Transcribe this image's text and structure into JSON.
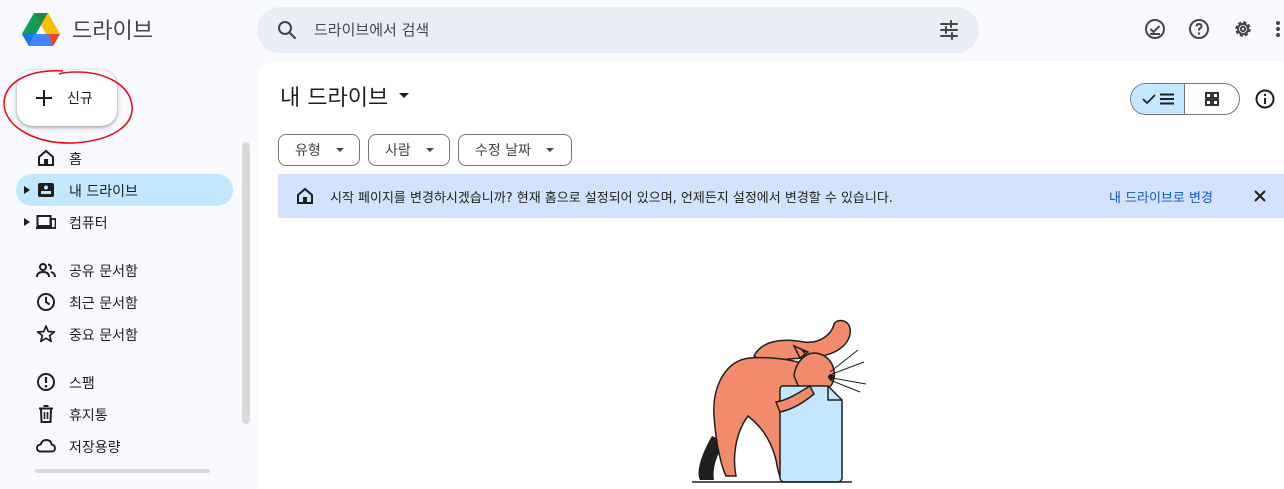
{
  "app": {
    "title": "드라이브"
  },
  "search": {
    "placeholder": "드라이브에서 검색"
  },
  "header_icons": [
    "ready-offline-icon",
    "help-icon",
    "settings-icon",
    "apps-icon"
  ],
  "sidebar": {
    "new_label": "신규",
    "items": [
      {
        "label": "홈",
        "icon": "home-icon"
      },
      {
        "label": "내 드라이브",
        "icon": "my-drive-icon",
        "active": true
      },
      {
        "label": "컴퓨터",
        "icon": "computers-icon"
      },
      {
        "label": "공유 문서함",
        "icon": "shared-icon"
      },
      {
        "label": "최근 문서함",
        "icon": "recent-icon"
      },
      {
        "label": "중요 문서함",
        "icon": "starred-icon"
      },
      {
        "label": "스팸",
        "icon": "spam-icon"
      },
      {
        "label": "휴지통",
        "icon": "trash-icon"
      },
      {
        "label": "저장용량",
        "icon": "storage-icon"
      }
    ]
  },
  "main": {
    "title": "내 드라이브",
    "filters": [
      "유형",
      "사람",
      "수정 날짜"
    ],
    "banner": {
      "message": "시작 페이지를 변경하시겠습니까? 현재 홈으로 설정되어 있으며, 언제든지 설정에서 변경할 수 있습니다.",
      "action": "내 드라이브로 변경"
    }
  },
  "colors": {
    "accent": "#0b57d0",
    "active_nav": "#c2e7ff",
    "banner_bg": "#d3e3fd",
    "search_bg": "#e9eef6",
    "annotation_red": "#e8101f"
  }
}
